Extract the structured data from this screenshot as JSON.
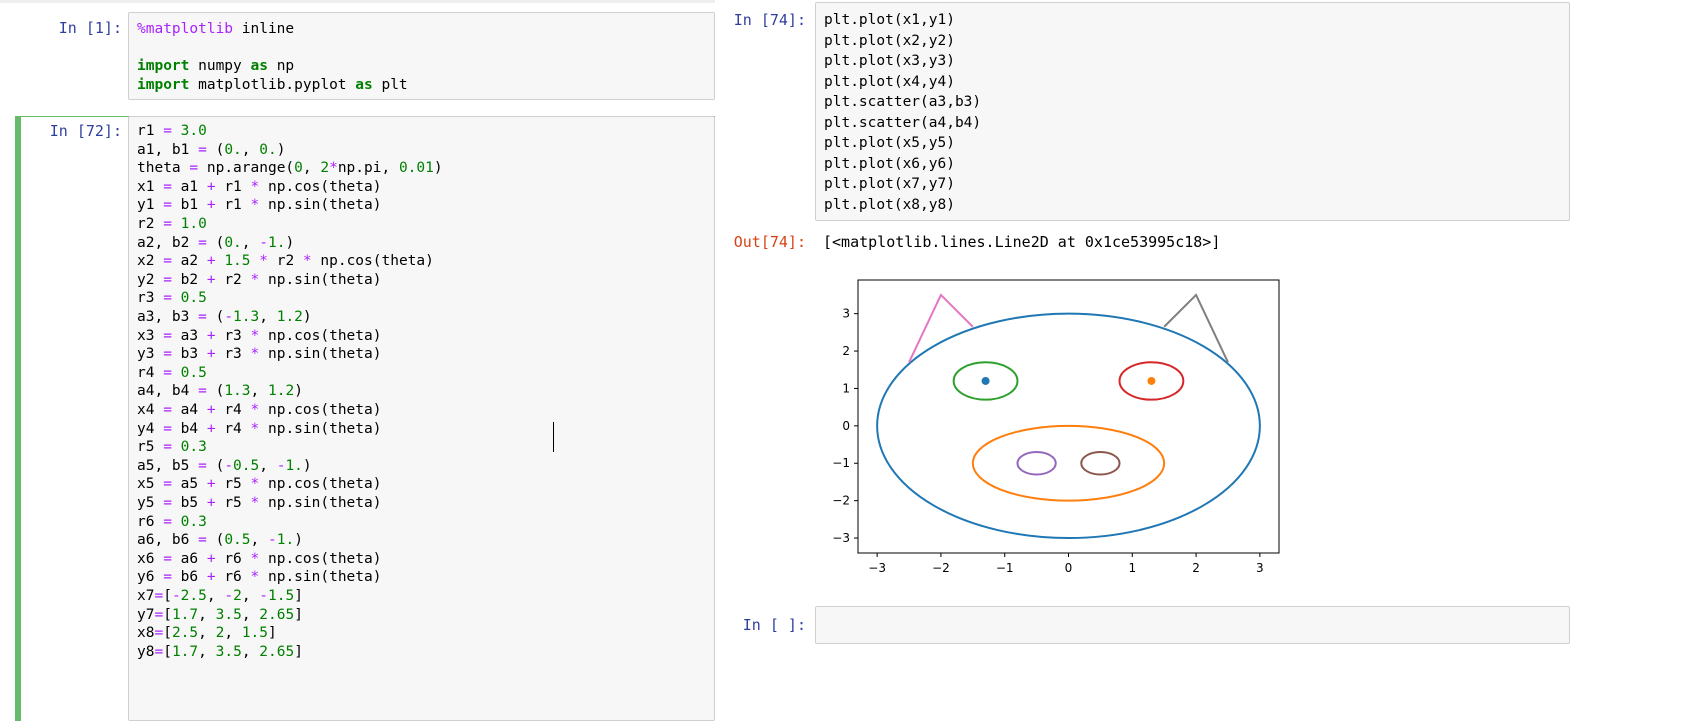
{
  "cells": {
    "c1": {
      "prompt": "In [1]:"
    },
    "c72": {
      "prompt": "In [72]:"
    },
    "c74": {
      "prompt": "In [74]:",
      "out_prompt": "Out[74]:",
      "output": "[<matplotlib.lines.Line2D at 0x1ce53995c18>]"
    },
    "empty": {
      "prompt": "In [ ]:"
    }
  },
  "code": {
    "c1": [
      [
        [
          "mg",
          "%matplotlib"
        ],
        [
          "plain",
          " inline"
        ]
      ],
      [],
      [
        [
          "kw",
          "import"
        ],
        [
          "plain",
          " numpy "
        ],
        [
          "kw",
          "as"
        ],
        [
          "plain",
          " np"
        ]
      ],
      [
        [
          "kw",
          "import"
        ],
        [
          "plain",
          " matplotlib.pyplot "
        ],
        [
          "kw",
          "as"
        ],
        [
          "plain",
          " plt"
        ]
      ]
    ],
    "c72": [
      [
        [
          "plain",
          "r1 "
        ],
        [
          "op",
          "="
        ],
        [
          "plain",
          " "
        ],
        [
          "nm",
          "3.0"
        ]
      ],
      [
        [
          "plain",
          "a1, b1 "
        ],
        [
          "op",
          "="
        ],
        [
          "plain",
          " ("
        ],
        [
          "nm",
          "0."
        ],
        [
          "plain",
          ", "
        ],
        [
          "nm",
          "0."
        ],
        [
          "plain",
          ")"
        ]
      ],
      [
        [
          "plain",
          "theta "
        ],
        [
          "op",
          "="
        ],
        [
          "plain",
          " np.arange("
        ],
        [
          "nm",
          "0"
        ],
        [
          "plain",
          ", "
        ],
        [
          "nm",
          "2"
        ],
        [
          "op",
          "*"
        ],
        [
          "plain",
          "np.pi, "
        ],
        [
          "nm",
          "0.01"
        ],
        [
          "plain",
          ")"
        ]
      ],
      [
        [
          "plain",
          "x1 "
        ],
        [
          "op",
          "="
        ],
        [
          "plain",
          " a1 "
        ],
        [
          "op",
          "+"
        ],
        [
          "plain",
          " r1 "
        ],
        [
          "op",
          "*"
        ],
        [
          "plain",
          " np.cos(theta)"
        ]
      ],
      [
        [
          "plain",
          "y1 "
        ],
        [
          "op",
          "="
        ],
        [
          "plain",
          " b1 "
        ],
        [
          "op",
          "+"
        ],
        [
          "plain",
          " r1 "
        ],
        [
          "op",
          "*"
        ],
        [
          "plain",
          " np.sin(theta)"
        ]
      ],
      [
        [
          "plain",
          "r2 "
        ],
        [
          "op",
          "="
        ],
        [
          "plain",
          " "
        ],
        [
          "nm",
          "1.0"
        ]
      ],
      [
        [
          "plain",
          "a2, b2 "
        ],
        [
          "op",
          "="
        ],
        [
          "plain",
          " ("
        ],
        [
          "nm",
          "0."
        ],
        [
          "plain",
          ", "
        ],
        [
          "op",
          "-"
        ],
        [
          "nm",
          "1."
        ],
        [
          "plain",
          ")"
        ]
      ],
      [
        [
          "plain",
          "x2 "
        ],
        [
          "op",
          "="
        ],
        [
          "plain",
          " a2 "
        ],
        [
          "op",
          "+"
        ],
        [
          "plain",
          " "
        ],
        [
          "nm",
          "1.5"
        ],
        [
          "plain",
          " "
        ],
        [
          "op",
          "*"
        ],
        [
          "plain",
          " r2 "
        ],
        [
          "op",
          "*"
        ],
        [
          "plain",
          " np.cos(theta)"
        ]
      ],
      [
        [
          "plain",
          "y2 "
        ],
        [
          "op",
          "="
        ],
        [
          "plain",
          " b2 "
        ],
        [
          "op",
          "+"
        ],
        [
          "plain",
          " r2 "
        ],
        [
          "op",
          "*"
        ],
        [
          "plain",
          " np.sin(theta)"
        ]
      ],
      [
        [
          "plain",
          "r3 "
        ],
        [
          "op",
          "="
        ],
        [
          "plain",
          " "
        ],
        [
          "nm",
          "0.5"
        ]
      ],
      [
        [
          "plain",
          "a3, b3 "
        ],
        [
          "op",
          "="
        ],
        [
          "plain",
          " ("
        ],
        [
          "op",
          "-"
        ],
        [
          "nm",
          "1.3"
        ],
        [
          "plain",
          ", "
        ],
        [
          "nm",
          "1.2"
        ],
        [
          "plain",
          ")"
        ]
      ],
      [
        [
          "plain",
          "x3 "
        ],
        [
          "op",
          "="
        ],
        [
          "plain",
          " a3 "
        ],
        [
          "op",
          "+"
        ],
        [
          "plain",
          " r3 "
        ],
        [
          "op",
          "*"
        ],
        [
          "plain",
          " np.cos(theta)"
        ]
      ],
      [
        [
          "plain",
          "y3 "
        ],
        [
          "op",
          "="
        ],
        [
          "plain",
          " b3 "
        ],
        [
          "op",
          "+"
        ],
        [
          "plain",
          " r3 "
        ],
        [
          "op",
          "*"
        ],
        [
          "plain",
          " np.sin(theta)"
        ]
      ],
      [
        [
          "plain",
          "r4 "
        ],
        [
          "op",
          "="
        ],
        [
          "plain",
          " "
        ],
        [
          "nm",
          "0.5"
        ]
      ],
      [
        [
          "plain",
          "a4, b4 "
        ],
        [
          "op",
          "="
        ],
        [
          "plain",
          " ("
        ],
        [
          "nm",
          "1.3"
        ],
        [
          "plain",
          ", "
        ],
        [
          "nm",
          "1.2"
        ],
        [
          "plain",
          ")"
        ]
      ],
      [
        [
          "plain",
          "x4 "
        ],
        [
          "op",
          "="
        ],
        [
          "plain",
          " a4 "
        ],
        [
          "op",
          "+"
        ],
        [
          "plain",
          " r4 "
        ],
        [
          "op",
          "*"
        ],
        [
          "plain",
          " np.cos(theta)"
        ]
      ],
      [
        [
          "plain",
          "y4 "
        ],
        [
          "op",
          "="
        ],
        [
          "plain",
          " b4 "
        ],
        [
          "op",
          "+"
        ],
        [
          "plain",
          " r4 "
        ],
        [
          "op",
          "*"
        ],
        [
          "plain",
          " np.sin(theta)"
        ]
      ],
      [
        [
          "plain",
          "r5 "
        ],
        [
          "op",
          "="
        ],
        [
          "plain",
          " "
        ],
        [
          "nm",
          "0.3"
        ]
      ],
      [
        [
          "plain",
          "a5, b5 "
        ],
        [
          "op",
          "="
        ],
        [
          "plain",
          " ("
        ],
        [
          "op",
          "-"
        ],
        [
          "nm",
          "0.5"
        ],
        [
          "plain",
          ", "
        ],
        [
          "op",
          "-"
        ],
        [
          "nm",
          "1."
        ],
        [
          "plain",
          ")"
        ]
      ],
      [
        [
          "plain",
          "x5 "
        ],
        [
          "op",
          "="
        ],
        [
          "plain",
          " a5 "
        ],
        [
          "op",
          "+"
        ],
        [
          "plain",
          " r5 "
        ],
        [
          "op",
          "*"
        ],
        [
          "plain",
          " np.cos(theta)"
        ]
      ],
      [
        [
          "plain",
          "y5 "
        ],
        [
          "op",
          "="
        ],
        [
          "plain",
          " b5 "
        ],
        [
          "op",
          "+"
        ],
        [
          "plain",
          " r5 "
        ],
        [
          "op",
          "*"
        ],
        [
          "plain",
          " np.sin(theta)"
        ]
      ],
      [
        [
          "plain",
          "r6 "
        ],
        [
          "op",
          "="
        ],
        [
          "plain",
          " "
        ],
        [
          "nm",
          "0.3"
        ]
      ],
      [
        [
          "plain",
          "a6, b6 "
        ],
        [
          "op",
          "="
        ],
        [
          "plain",
          " ("
        ],
        [
          "nm",
          "0.5"
        ],
        [
          "plain",
          ", "
        ],
        [
          "op",
          "-"
        ],
        [
          "nm",
          "1."
        ],
        [
          "plain",
          ")"
        ]
      ],
      [
        [
          "plain",
          "x6 "
        ],
        [
          "op",
          "="
        ],
        [
          "plain",
          " a6 "
        ],
        [
          "op",
          "+"
        ],
        [
          "plain",
          " r6 "
        ],
        [
          "op",
          "*"
        ],
        [
          "plain",
          " np.cos(theta)"
        ]
      ],
      [
        [
          "plain",
          "y6 "
        ],
        [
          "op",
          "="
        ],
        [
          "plain",
          " b6 "
        ],
        [
          "op",
          "+"
        ],
        [
          "plain",
          " r6 "
        ],
        [
          "op",
          "*"
        ],
        [
          "plain",
          " np.sin(theta)"
        ]
      ],
      [
        [
          "plain",
          "x7"
        ],
        [
          "op",
          "="
        ],
        [
          "plain",
          "["
        ],
        [
          "op",
          "-"
        ],
        [
          "nm",
          "2.5"
        ],
        [
          "plain",
          ", "
        ],
        [
          "op",
          "-"
        ],
        [
          "nm",
          "2"
        ],
        [
          "plain",
          ", "
        ],
        [
          "op",
          "-"
        ],
        [
          "nm",
          "1.5"
        ],
        [
          "plain",
          "]"
        ]
      ],
      [
        [
          "plain",
          "y7"
        ],
        [
          "op",
          "="
        ],
        [
          "plain",
          "["
        ],
        [
          "nm",
          "1.7"
        ],
        [
          "plain",
          ", "
        ],
        [
          "nm",
          "3.5"
        ],
        [
          "plain",
          ", "
        ],
        [
          "nm",
          "2.65"
        ],
        [
          "plain",
          "]"
        ]
      ],
      [
        [
          "plain",
          "x8"
        ],
        [
          "op",
          "="
        ],
        [
          "plain",
          "["
        ],
        [
          "nm",
          "2.5"
        ],
        [
          "plain",
          ", "
        ],
        [
          "nm",
          "2"
        ],
        [
          "plain",
          ", "
        ],
        [
          "nm",
          "1.5"
        ],
        [
          "plain",
          "]"
        ]
      ],
      [
        [
          "plain",
          "y8"
        ],
        [
          "op",
          "="
        ],
        [
          "plain",
          "["
        ],
        [
          "nm",
          "1.7"
        ],
        [
          "plain",
          ", "
        ],
        [
          "nm",
          "3.5"
        ],
        [
          "plain",
          ", "
        ],
        [
          "nm",
          "2.65"
        ],
        [
          "plain",
          "]"
        ]
      ]
    ],
    "c74": [
      [
        [
          "plain",
          "plt.plot(x1,y1)"
        ]
      ],
      [
        [
          "plain",
          "plt.plot(x2,y2)"
        ]
      ],
      [
        [
          "plain",
          "plt.plot(x3,y3)"
        ]
      ],
      [
        [
          "plain",
          "plt.plot(x4,y4)"
        ]
      ],
      [
        [
          "plain",
          "plt.scatter(a3,b3)"
        ]
      ],
      [
        [
          "plain",
          "plt.scatter(a4,b4)"
        ]
      ],
      [
        [
          "plain",
          "plt.plot(x5,y5)"
        ]
      ],
      [
        [
          "plain",
          "plt.plot(x6,y6)"
        ]
      ],
      [
        [
          "plain",
          "plt.plot(x7,y7)"
        ]
      ],
      [
        [
          "plain",
          "plt.plot(x8,y8)"
        ]
      ]
    ]
  },
  "syntax_colors": {
    "keyword": "#008000",
    "operator": "#aa22ff",
    "number": "#008000",
    "magic": "#aa22ff",
    "plain": "#000000"
  },
  "chart_data": {
    "type": "line",
    "title": "",
    "xlabel": "",
    "ylabel": "",
    "xlim": [
      -3.3,
      3.3
    ],
    "ylim": [
      -3.4,
      3.9
    ],
    "xticks": [
      "−3",
      "−2",
      "−1",
      "0",
      "1",
      "2",
      "3"
    ],
    "yticks": [
      "−3",
      "−2",
      "−1",
      "0",
      "1",
      "2",
      "3"
    ],
    "xtick_values": [
      -3,
      -2,
      -1,
      0,
      1,
      2,
      3
    ],
    "ytick_values": [
      -3,
      -2,
      -1,
      0,
      1,
      2,
      3
    ],
    "grid": false,
    "series": [
      {
        "kind": "ellipse",
        "cx": 0,
        "cy": 0,
        "rx": 3.0,
        "ry": 3.0,
        "color": "#1f77b4"
      },
      {
        "kind": "ellipse",
        "cx": 0,
        "cy": -1,
        "rx": 1.5,
        "ry": 1.0,
        "color": "#ff7f0e"
      },
      {
        "kind": "ellipse",
        "cx": -1.3,
        "cy": 1.2,
        "rx": 0.5,
        "ry": 0.5,
        "color": "#2ca02c"
      },
      {
        "kind": "ellipse",
        "cx": 1.3,
        "cy": 1.2,
        "rx": 0.5,
        "ry": 0.5,
        "color": "#d62728"
      },
      {
        "kind": "point",
        "x": -1.3,
        "y": 1.2,
        "color": "#1f77b4"
      },
      {
        "kind": "point",
        "x": 1.3,
        "y": 1.2,
        "color": "#ff7f0e"
      },
      {
        "kind": "ellipse",
        "cx": -0.5,
        "cy": -1,
        "rx": 0.3,
        "ry": 0.3,
        "color": "#9467bd"
      },
      {
        "kind": "ellipse",
        "cx": 0.5,
        "cy": -1,
        "rx": 0.3,
        "ry": 0.3,
        "color": "#8c564b"
      },
      {
        "kind": "polyline",
        "x": [
          -2.5,
          -2,
          -1.5
        ],
        "y": [
          1.7,
          3.5,
          2.65
        ],
        "color": "#e377c2"
      },
      {
        "kind": "polyline",
        "x": [
          2.5,
          2,
          1.5
        ],
        "y": [
          1.7,
          3.5,
          2.65
        ],
        "color": "#7f7f7f"
      }
    ]
  }
}
